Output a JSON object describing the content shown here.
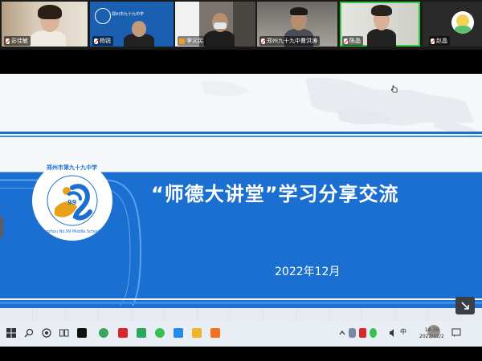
{
  "participants": [
    {
      "name": "彭佳敏",
      "muted": true
    },
    {
      "name": "杨锐",
      "muted": true
    },
    {
      "name": "李义民",
      "muted": true
    },
    {
      "name": "郑州九十九中曹洪涛",
      "muted": true
    },
    {
      "name": "陈晶",
      "muted": true
    },
    {
      "name": "赵晶",
      "muted": true
    }
  ],
  "tile2_caption": "郑州市九十九中学",
  "slide": {
    "title": "“师德大讲堂”学习分享交流",
    "date": "2022年12月",
    "logo_ring_top": "郑州市第九十九中学",
    "logo_ring_bottom": "Zhengzhou No.99 Middle School",
    "logo_number": "99",
    "colors": {
      "band": "#1a6fd0",
      "band_light": "#3a8ee6",
      "accent": "#ffffff"
    }
  },
  "taskbar": {
    "icons": [
      "windows-start-icon",
      "search-icon",
      "record-icon",
      "task-view-icon",
      "app-icon",
      "edge-icon",
      "wps-icon",
      "files-icon",
      "wechat-icon",
      "mail-icon",
      "folder-icon",
      "media-icon"
    ],
    "tray": [
      "chevron-up-icon",
      "cloud-icon",
      "game-icon",
      "shield-icon",
      "sound-icon",
      "ime-icon",
      "notification-icon"
    ],
    "ime_label": "中",
    "time": "14:39",
    "date": "2022/12/2"
  }
}
